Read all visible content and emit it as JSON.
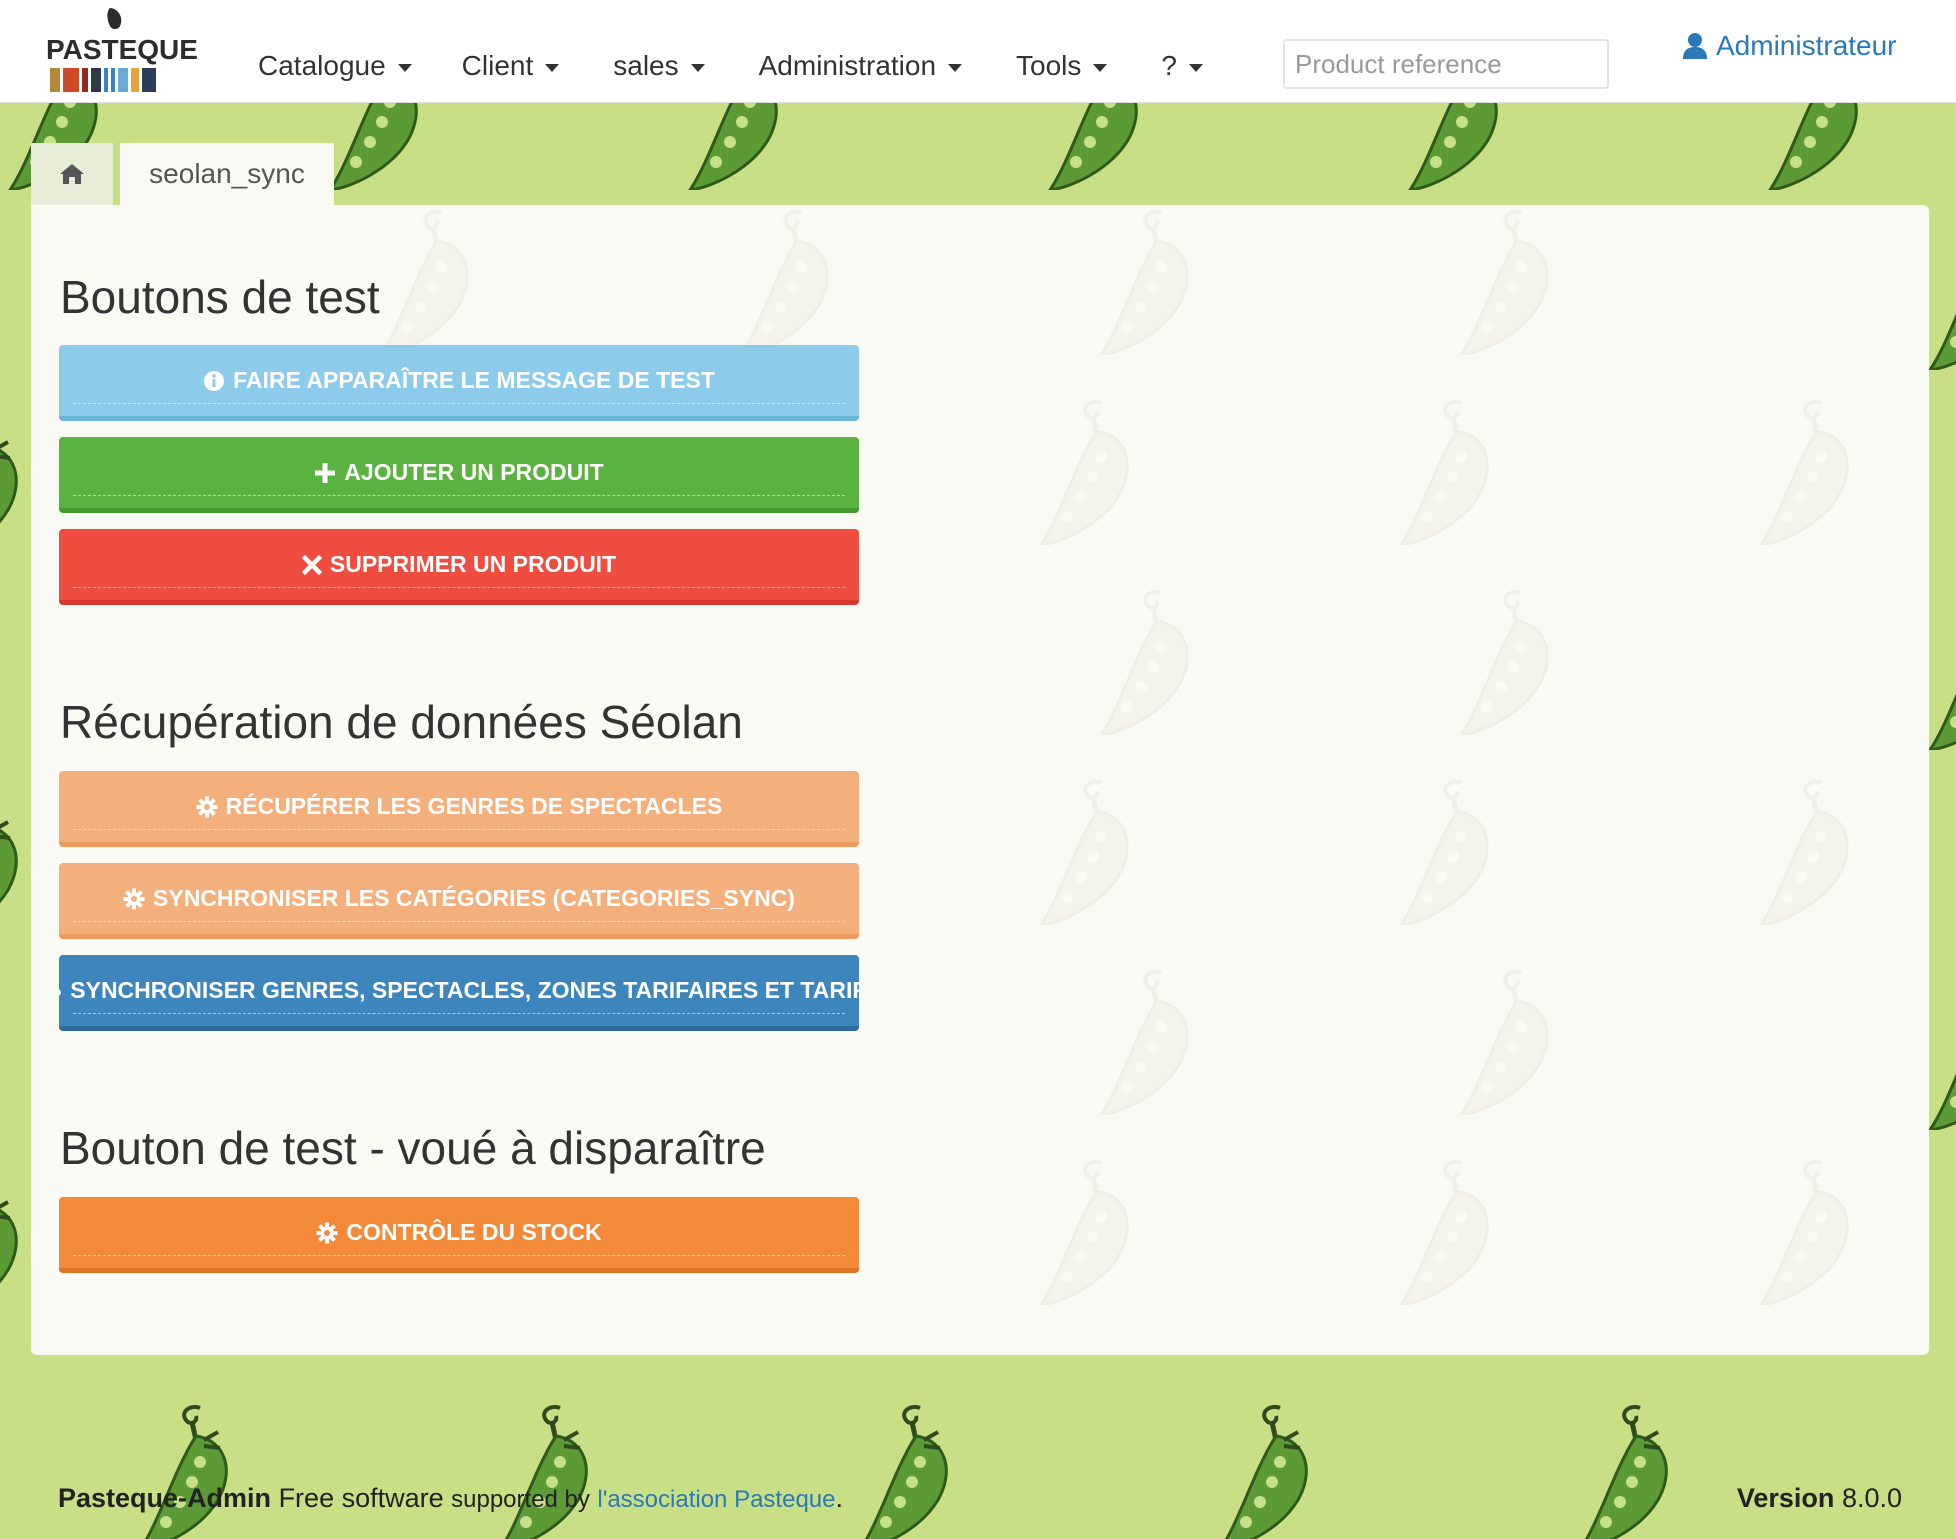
{
  "app": {
    "logo_text": "PASTEQUE",
    "logo_bar_colors": [
      "#b5873c",
      "#d04a2a",
      "#8a2f24",
      "#2f3a4c",
      "#3a83c5",
      "#3a83c5",
      "#6aaad6",
      "#e6a43a",
      "#2c3e5c"
    ]
  },
  "nav": {
    "items": [
      {
        "label": "Catalogue"
      },
      {
        "label": "Client"
      },
      {
        "label": "sales"
      },
      {
        "label": "Administration"
      },
      {
        "label": "Tools"
      },
      {
        "label": "?"
      }
    ],
    "search_placeholder": "Product reference",
    "user_label": "Administrateur"
  },
  "breadcrumb": {
    "current": "seolan_sync"
  },
  "sections": [
    {
      "title": "Boutons de test",
      "buttons": [
        {
          "label": "Faire apparaître le message de test",
          "icon": "info-circle-icon",
          "color": "#8ccbea"
        },
        {
          "label": "Ajouter un produit",
          "icon": "plus-icon",
          "color": "#5ab340"
        },
        {
          "label": "Supprimer un produit",
          "icon": "close-icon",
          "color": "#ee4d40"
        }
      ]
    },
    {
      "title": "Récupération de données Séolan",
      "buttons": [
        {
          "label": "Récupérer les genres de spectacles",
          "icon": "gear-icon",
          "color": "#f4b07c"
        },
        {
          "label": "Synchroniser les catégories (categories_sync)",
          "icon": "gear-icon",
          "color": "#f4b07c"
        },
        {
          "label": "Synchroniser genres, spectacles, zones tarifaires et tarifs",
          "icon": "cloud-download-icon",
          "color": "#3d86bd"
        }
      ]
    },
    {
      "title": "Bouton de test - voué à disparaître",
      "buttons": [
        {
          "label": "Contrôle du stock",
          "icon": "gear-icon",
          "color": "#f28a3a"
        }
      ]
    }
  ],
  "footer": {
    "product": "Pasteque-Admin",
    "free_software": "Free software",
    "supported_by": "supported by",
    "association_link": "l'association Pasteque",
    "period": ".",
    "version_label": "Version",
    "version_number": "8.0.0"
  }
}
